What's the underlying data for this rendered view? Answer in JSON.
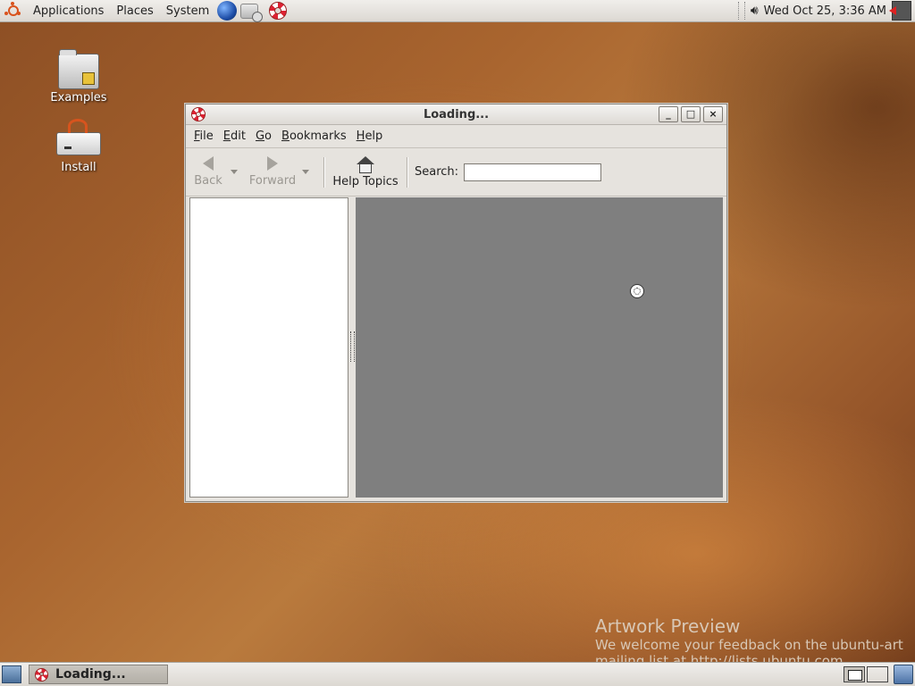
{
  "top_panel": {
    "menus": [
      "Applications",
      "Places",
      "System"
    ],
    "clock": "Wed Oct 25,  3:36 AM",
    "launchers": [
      "web-browser-icon",
      "mail-icon",
      "help-icon"
    ]
  },
  "desktop": {
    "icons": [
      {
        "label": "Examples",
        "icon": "examples-folder-icon"
      },
      {
        "label": "Install",
        "icon": "install-drive-icon"
      }
    ]
  },
  "window": {
    "title": "Loading...",
    "buttons": {
      "minimize": "_",
      "maximize": "□",
      "close": "×"
    },
    "menu": [
      "File",
      "Edit",
      "Go",
      "Bookmarks",
      "Help"
    ],
    "toolbar": {
      "back_label": "Back",
      "forward_label": "Forward",
      "help_topics_label": "Help Topics",
      "search_label": "Search:",
      "search_value": ""
    }
  },
  "artwork": {
    "heading": "Artwork Preview",
    "line1": "We welcome your feedback on the ubuntu-art",
    "line2": "mailing list at http://lists.ubuntu.com"
  },
  "bottom_panel": {
    "task_label": "Loading..."
  }
}
